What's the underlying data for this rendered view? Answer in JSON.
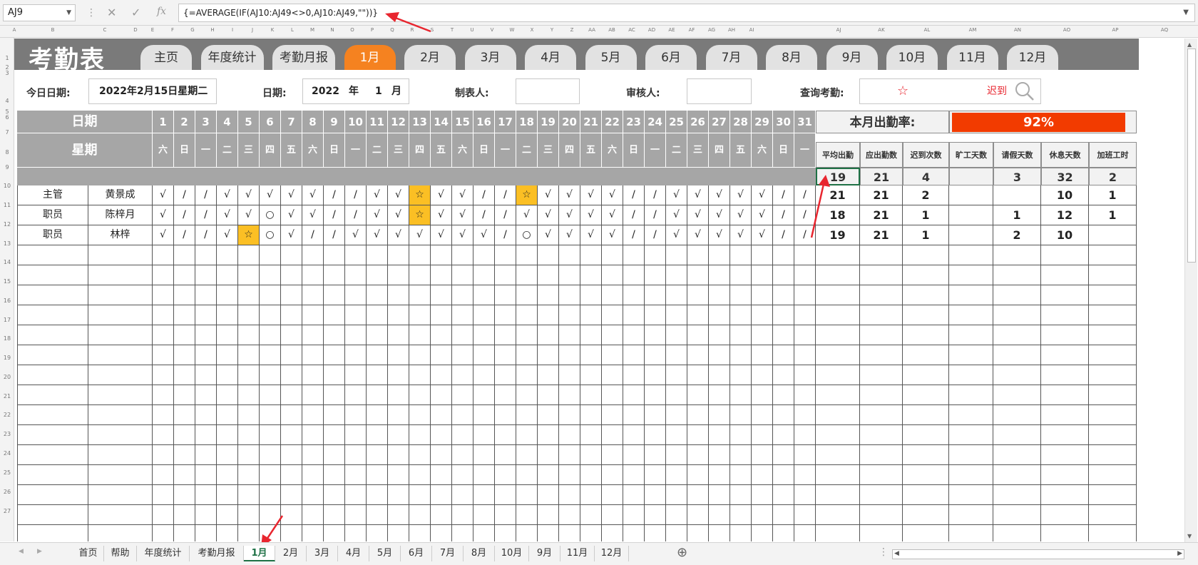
{
  "formula_bar": {
    "name_box": "AJ9",
    "formula": "{=AVERAGE(IF(AJ10:AJ49<>0,AJ10:AJ49,\"\"))}",
    "cancel_glyph": "✕",
    "enter_glyph": "✓",
    "fx_glyph": "fx"
  },
  "column_letters": [
    "A",
    "B",
    "C",
    "D",
    "E",
    "F",
    "G",
    "H",
    "I",
    "J",
    "K",
    "L",
    "M",
    "N",
    "O",
    "P",
    "Q",
    "R",
    "S",
    "T",
    "U",
    "V",
    "W",
    "X",
    "Y",
    "Z",
    "AA",
    "AB",
    "AC",
    "AD",
    "AE",
    "AF",
    "AG",
    "AH",
    "AI",
    "AJ",
    "AK",
    "AL",
    "AM",
    "AN",
    "AO",
    "AP",
    "AQ"
  ],
  "row_numbers": [
    "1",
    "2",
    "3",
    "4",
    "5",
    "6",
    "7",
    "8",
    "9",
    "10",
    "11",
    "12",
    "13",
    "14",
    "15",
    "16",
    "17",
    "18",
    "19",
    "20",
    "21",
    "22",
    "23",
    "24",
    "25",
    "26",
    "27"
  ],
  "app_title": "考勤表",
  "nav_tabs": [
    "主页",
    "年度统计",
    "考勤月报",
    "1月",
    "2月",
    "3月",
    "4月",
    "5月",
    "6月",
    "7月",
    "8月",
    "9月",
    "10月",
    "11月",
    "12月"
  ],
  "active_nav_tab": "1月",
  "info": {
    "today_label": "今日日期:",
    "today_value": "2022年2月15日星期二",
    "date_label": "日期:",
    "year": "2022",
    "year_unit": "年",
    "month": "1",
    "month_unit": "月",
    "maker_label": "制表人:",
    "maker_value": "",
    "reviewer_label": "审核人:",
    "reviewer_value": "",
    "query_label": "查询考勤:",
    "query_symbol": "☆",
    "query_value": "迟到"
  },
  "header": {
    "date_label": "日期",
    "week_label": "星期",
    "days": [
      "1",
      "2",
      "3",
      "4",
      "5",
      "6",
      "7",
      "8",
      "9",
      "10",
      "11",
      "12",
      "13",
      "14",
      "15",
      "16",
      "17",
      "18",
      "19",
      "20",
      "21",
      "22",
      "23",
      "24",
      "25",
      "26",
      "27",
      "28",
      "29",
      "30",
      "31"
    ],
    "weekdays": [
      "六",
      "日",
      "一",
      "二",
      "三",
      "四",
      "五",
      "六",
      "日",
      "一",
      "二",
      "三",
      "四",
      "五",
      "六",
      "日",
      "一",
      "二",
      "三",
      "四",
      "五",
      "六",
      "日",
      "一",
      "二",
      "三",
      "四",
      "五",
      "六",
      "日",
      "一"
    ],
    "rate_label": "本月出勤率:",
    "rate_value": "92%",
    "stat_headers": [
      "平均出勤",
      "应出勤数",
      "迟到次数",
      "旷工天数",
      "请假天数",
      "休息天数",
      "加班工时"
    ],
    "stat_totals": [
      "19",
      "21",
      "4",
      "",
      "3",
      "32",
      "2"
    ]
  },
  "employees": [
    {
      "role": "主管",
      "name": "黄景成",
      "marks": [
        "√",
        "/",
        "/",
        "√",
        "√",
        "√",
        "√",
        "√",
        "/",
        "/",
        "√",
        "√",
        "☆",
        "√",
        "√",
        "/",
        "/",
        "☆",
        "√",
        "√",
        "√",
        "√",
        "/",
        "/",
        "√",
        "√",
        "√",
        "√",
        "√",
        "/",
        "/"
      ],
      "stats": [
        "21",
        "21",
        "2",
        "",
        "",
        "10",
        "1"
      ]
    },
    {
      "role": "职员",
      "name": "陈梓月",
      "marks": [
        "√",
        "/",
        "/",
        "√",
        "√",
        "○",
        "√",
        "√",
        "/",
        "/",
        "√",
        "√",
        "☆",
        "√",
        "√",
        "/",
        "/",
        "√",
        "√",
        "√",
        "√",
        "√",
        "/",
        "/",
        "√",
        "√",
        "√",
        "√",
        "√",
        "/",
        "/"
      ],
      "stats": [
        "18",
        "21",
        "1",
        "",
        "1",
        "12",
        "1"
      ]
    },
    {
      "role": "职员",
      "name": "林梓",
      "marks": [
        "√",
        "/",
        "/",
        "√",
        "☆",
        "○",
        "√",
        "/",
        "/",
        "√",
        "√",
        "√",
        "√",
        "√",
        "√",
        "√",
        "/",
        "○",
        "√",
        "√",
        "√",
        "√",
        "/",
        "/",
        "√",
        "√",
        "√",
        "√",
        "√",
        "/",
        "/"
      ],
      "stats": [
        "19",
        "21",
        "1",
        "",
        "2",
        "10",
        ""
      ]
    }
  ],
  "highlight_symbol": "☆",
  "sheet_tabs": [
    "首页",
    "帮助",
    "年度统计",
    "考勤月报",
    "1月",
    "2月",
    "3月",
    "4月",
    "5月",
    "6月",
    "7月",
    "8月",
    "10月",
    "9月",
    "11月",
    "12月"
  ],
  "active_sheet": "1月",
  "colors": {
    "band": "#7a7a7a",
    "active_tab": "#f58220",
    "rate_bar": "#f23b00",
    "highlight": "#fbbf24",
    "accent_query": "#e8262f",
    "arrow": "#e8262f"
  }
}
